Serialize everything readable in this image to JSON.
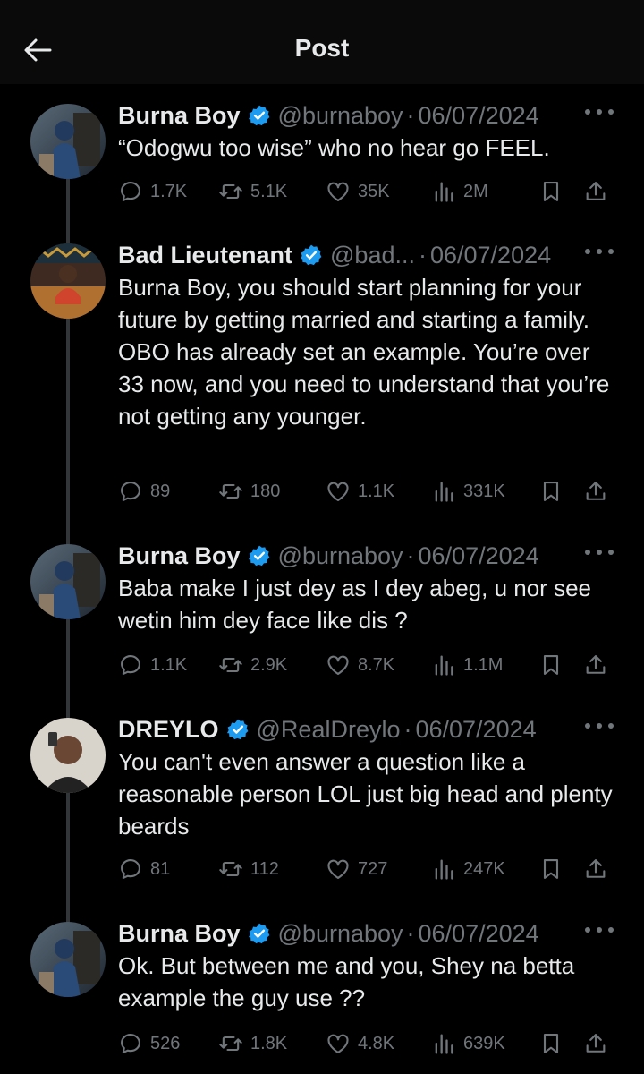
{
  "header": {
    "title": "Post"
  },
  "icons": {
    "back": "arrow-left-icon",
    "verified": "verified-badge-icon",
    "reply": "reply-icon",
    "retweet": "retweet-icon",
    "like": "heart-icon",
    "views": "views-icon",
    "bookmark": "bookmark-icon",
    "share": "share-icon",
    "more": "more-icon"
  },
  "colors": {
    "background": "#000000",
    "text": "#e7e9ea",
    "muted": "#71767b",
    "verified": "#1d9bf0"
  },
  "tweets": [
    {
      "name": "Burna Boy",
      "handle": "@burnaboy",
      "dot": "·",
      "date": "06/07/2024",
      "text": "“Odogwu too wise”  who no hear go FEEL.",
      "replies": "1.7K",
      "retweets": "5.1K",
      "likes": "35K",
      "views": "2M"
    },
    {
      "name": "Bad Lieutenant",
      "handle": "@bad...",
      "dot": "·",
      "date": "06/07/2024",
      "text": "Burna Boy, you should start planning for your future by getting married and starting a family. OBO has already set an example. You’re over 33 now, and you need to understand that you’re not getting any younger.",
      "replies": "89",
      "retweets": "180",
      "likes": "1.1K",
      "views": "331K"
    },
    {
      "name": "Burna Boy",
      "handle": "@burnaboy",
      "dot": "·",
      "date": "06/07/2024",
      "text": "Baba make I just dey as I dey abeg, u nor see wetin him dey face like dis ?",
      "replies": "1.1K",
      "retweets": "2.9K",
      "likes": "8.7K",
      "views": "1.1M"
    },
    {
      "name": "DREYLO",
      "handle": "@RealDreylo",
      "dot": "·",
      "date": "06/07/2024",
      "text": "You can't even answer a question like a reasonable person LOL just big head and plenty beards",
      "replies": "81",
      "retweets": "112",
      "likes": "727",
      "views": "247K"
    },
    {
      "name": "Burna Boy",
      "handle": "@burnaboy",
      "dot": "·",
      "date": "06/07/2024",
      "text": "Ok. But between me and you, Shey na betta example the guy use ??",
      "replies": "526",
      "retweets": "1.8K",
      "likes": "4.8K",
      "views": "639K"
    }
  ]
}
